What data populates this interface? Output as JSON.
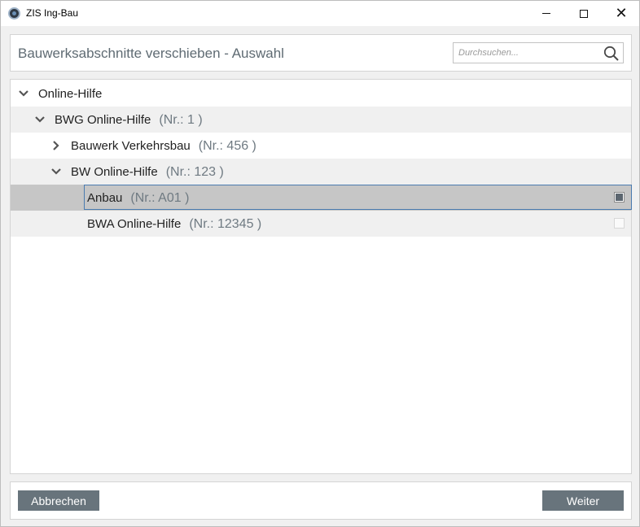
{
  "window": {
    "title": "ZIS Ing-Bau",
    "minimize_icon": "minimize-icon",
    "maximize_icon": "maximize-icon",
    "close_icon": "close-icon"
  },
  "header": {
    "title": "Bauwerksabschnitte verschieben - Auswahl",
    "search_placeholder": "Durchsuchen...",
    "search_value": ""
  },
  "tree": {
    "rows": [
      {
        "label": "Online-Hilfe",
        "nr": "",
        "expanded": true,
        "level": 0,
        "has_chevron": true,
        "checkbox": "none"
      },
      {
        "label": "BWG Online-Hilfe",
        "nr": "(Nr.: 1 )",
        "expanded": true,
        "level": 1,
        "has_chevron": true,
        "checkbox": "none"
      },
      {
        "label": "Bauwerk Verkehrsbau",
        "nr": "(Nr.: 456 )",
        "expanded": false,
        "level": 2,
        "has_chevron": true,
        "checkbox": "none"
      },
      {
        "label": "BW Online-Hilfe",
        "nr": "(Nr.: 123 )",
        "expanded": true,
        "level": 2,
        "has_chevron": true,
        "checkbox": "none"
      },
      {
        "label": "Anbau",
        "nr": "(Nr.: A01 )",
        "expanded": false,
        "level": 3,
        "has_chevron": false,
        "checkbox": "checked",
        "selected": true
      },
      {
        "label": "BWA Online-Hilfe",
        "nr": "(Nr.: 12345 )",
        "expanded": false,
        "level": 3,
        "has_chevron": false,
        "checkbox": "unchecked"
      }
    ]
  },
  "footer": {
    "cancel_label": "Abbrechen",
    "next_label": "Weiter"
  },
  "colors": {
    "button_bg": "#68747c",
    "selection_bg": "#c6c6c6",
    "selection_border": "#4a7bb0",
    "alt_row_bg": "#f0f0f0"
  }
}
